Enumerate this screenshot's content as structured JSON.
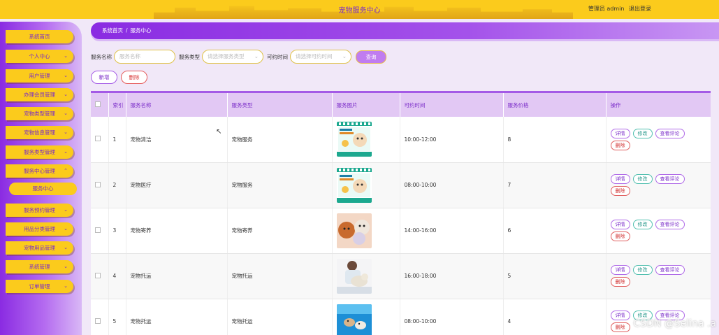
{
  "header": {
    "title": "宠物服务中心",
    "user_label": "管理员 admin",
    "logout": "退出登录",
    "colors": {
      "bar": "#fbcb1c",
      "title": "#7a2bc9"
    }
  },
  "sidebar": {
    "items": [
      {
        "label": "系统首页",
        "chevron": ""
      },
      {
        "label": "个人中心",
        "chevron": "⌄"
      },
      {
        "label": "用户管理",
        "chevron": "⌄"
      },
      {
        "label": "办理会员管理",
        "chevron": "⌄"
      },
      {
        "label": "宠物类型管理",
        "chevron": "⌄"
      },
      {
        "label": "宠物信息管理",
        "chevron": "⌄"
      },
      {
        "label": "服务类型管理",
        "chevron": "⌄"
      },
      {
        "label": "服务中心管理",
        "chevron": "⌃"
      },
      {
        "label": "服务预约管理",
        "chevron": "⌄"
      },
      {
        "label": "用品分类管理",
        "chevron": "⌄"
      },
      {
        "label": "宠物用品管理",
        "chevron": "⌄"
      },
      {
        "label": "系统管理",
        "chevron": "⌄"
      },
      {
        "label": "订单管理",
        "chevron": "⌄"
      }
    ],
    "active_sub": "服务中心"
  },
  "breadcrumb": {
    "home": "系统首页",
    "sep": "/",
    "current": "服务中心"
  },
  "search": {
    "name_label": "服务名称",
    "name_placeholder": "服务名称",
    "type_label": "服务类型",
    "type_placeholder": "请选择服务类型",
    "time_label": "可约时间",
    "time_placeholder": "请选择可约时间",
    "query_button": "查询"
  },
  "actions": {
    "add": "新增",
    "delete": "删除"
  },
  "table": {
    "columns": [
      "索引",
      "服务名称",
      "服务类型",
      "服务图片",
      "可约时间",
      "服务价格",
      "操作"
    ],
    "rows": [
      {
        "index": "1",
        "name": "宠物清洁",
        "type": "宠物服务",
        "image": "promo-card",
        "time": "10:00-12:00",
        "price": "8"
      },
      {
        "index": "2",
        "name": "宠物医疗",
        "type": "宠物服务",
        "image": "promo-card",
        "time": "08:00-10:00",
        "price": "7"
      },
      {
        "index": "3",
        "name": "宠物寄养",
        "type": "宠物寄养",
        "image": "puppies-photo",
        "time": "14:00-16:00",
        "price": "6"
      },
      {
        "index": "4",
        "name": "宠物托运",
        "type": "宠物托运",
        "image": "vet-photo",
        "time": "16:00-18:00",
        "price": "5"
      },
      {
        "index": "5",
        "name": "宠物托运",
        "type": "宠物托运",
        "image": "swim-photo",
        "time": "08:00-10:00",
        "price": "4"
      }
    ],
    "op_labels": {
      "detail": "详情",
      "edit": "修改",
      "review": "查看评论",
      "delete": "删除"
    }
  },
  "watermark": "CSDN @Selina .a"
}
